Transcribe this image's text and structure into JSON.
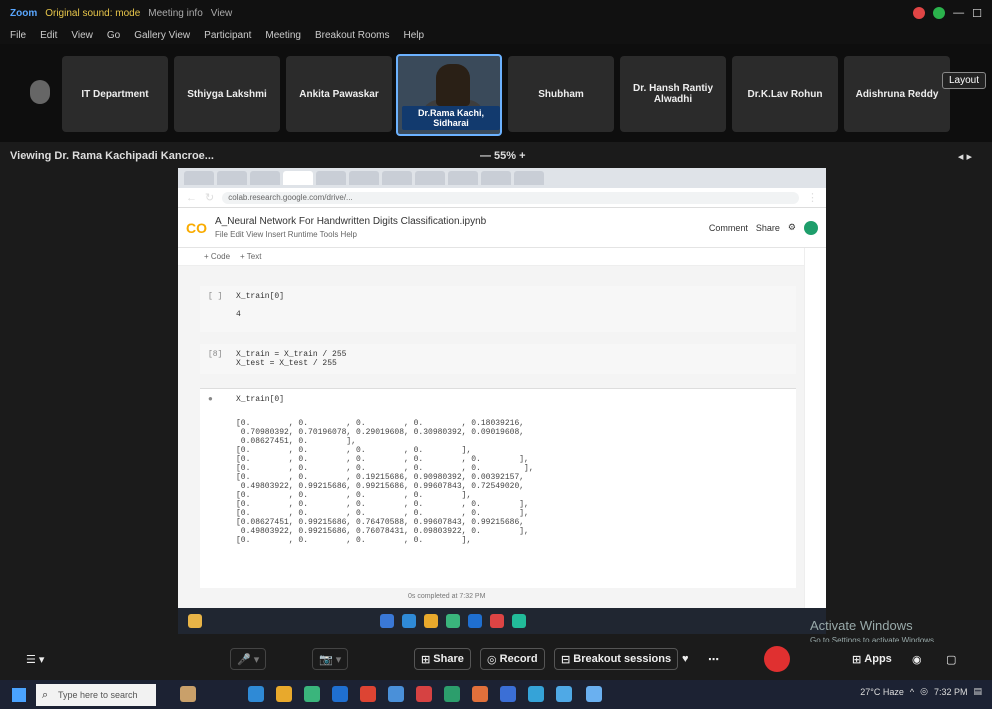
{
  "titlebar": {
    "app_name": "Zoom",
    "mode": "Original sound: mode",
    "meeting_info": "Meeting info",
    "view_label": "View"
  },
  "menubar": [
    "File",
    "Edit",
    "View",
    "Go",
    "Gallery View",
    "Participant",
    "Meeting",
    "Breakout Rooms",
    "Help"
  ],
  "participants": [
    {
      "name": "IT Department"
    },
    {
      "name": "Sthiyga Lakshmi"
    },
    {
      "name": "Ankita Pawaskar"
    },
    {
      "name": "Dr.Rama Kachi, Sidharai",
      "active": true
    },
    {
      "name": "Shubham"
    },
    {
      "name": "Dr. Hansh Rantiy Alwadhi"
    },
    {
      "name": "Dr.K.Lav Rohun"
    },
    {
      "name": "Adishruna Reddy"
    }
  ],
  "layout_button": "Layout",
  "viewing": "Viewing Dr. Rama Kachipadi Kancroe...",
  "zoom_level": "— 55% +",
  "browser": {
    "url": "colab.research.google.com/drive/...",
    "notebook_title": "A_Neural Network For Handwritten Digits Classification.ipynb",
    "notebook_menu": "File  Edit  View  Insert  Runtime  Tools  Help",
    "comment_label": "Comment",
    "share_label": "Share",
    "toolbar_code": "+ Code",
    "toolbar_text": "+ Text",
    "cell1_prompt": "[ ]",
    "cell1_code": "X_train[0]",
    "cell1_output": "4",
    "cell2_prompt": "[8]",
    "cell2_code": "X_train = X_train / 255\nX_test = X_test / 255",
    "cell3_code": "X_train[0]",
    "output_table": "[0.        , 0.        , 0.        , 0.        , 0.18039216,\n 0.70980392, 0.70196078, 0.29019608, 0.30980392, 0.09019608,\n 0.08627451, 0.        ],\n[0.        , 0.        , 0.        , 0.        ],\n[0.        , 0.        , 0.        , 0.        , 0.        ],\n[0.        , 0.        , 0.        , 0.        , 0.         ],\n[0.        , 0.        , 0.19215686, 0.90980392, 0.00392157,\n 0.49803922, 0.99215686, 0.99215686, 0.99607843, 0.72549020,\n[0.        , 0.        , 0.        , 0.        ],\n[0.        , 0.        , 0.        , 0.        , 0.        ],\n[0.        , 0.        , 0.        , 0.        , 0.        ],\n[0.08627451, 0.99215686, 0.76470588, 0.99607843, 0.99215686,\n 0.49803922, 0.99215686, 0.76078431, 0.09803922, 0.        ],\n[0.        , 0.        , 0.        , 0.        ],",
    "status_line": "0s    completed at 7:32 PM"
  },
  "watermark": {
    "line1": "Activate Windows",
    "line2": "Go to Settings to activate Windows."
  },
  "controls": {
    "share": "Share",
    "record": "Record",
    "breakout": "Breakout sessions",
    "apps": "Apps"
  },
  "taskbar": {
    "search_placeholder": "Type here to search",
    "weather": "27°C Haze",
    "time": "7:32 PM"
  },
  "colors": {
    "accent": "#5aa7ff",
    "end_red": "#e03030",
    "colab_orange": "#f9ab00"
  }
}
